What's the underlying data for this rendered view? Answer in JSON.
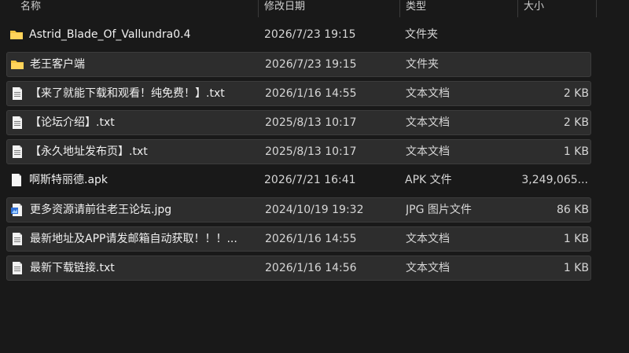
{
  "columns": {
    "name": "名称",
    "date": "修改日期",
    "type": "类型",
    "size": "大小"
  },
  "files": [
    {
      "name": "Astrid_Blade_Of_Vallundra0.4",
      "date": "2026/7/23 19:15",
      "type": "文件夹",
      "size": "",
      "icon": "folder-icon",
      "selected": false
    },
    {
      "name": "老王客户端",
      "date": "2026/7/23 19:15",
      "type": "文件夹",
      "size": "",
      "icon": "folder-icon",
      "selected": true
    },
    {
      "name": "【来了就能下载和观看！纯免费！】.txt",
      "date": "2026/1/16 14:55",
      "type": "文本文档",
      "size": "2 KB",
      "icon": "text-file-icon",
      "selected": true
    },
    {
      "name": "【论坛介绍】.txt",
      "date": "2025/8/13 10:17",
      "type": "文本文档",
      "size": "2 KB",
      "icon": "text-file-icon",
      "selected": true
    },
    {
      "name": "【永久地址发布页】.txt",
      "date": "2025/8/13 10:17",
      "type": "文本文档",
      "size": "1 KB",
      "icon": "text-file-icon",
      "selected": true
    },
    {
      "name": "啊斯特丽德.apk",
      "date": "2026/7/21 16:41",
      "type": "APK 文件",
      "size": "3,249,065...",
      "icon": "file-icon",
      "selected": false
    },
    {
      "name": "更多资源请前往老王论坛.jpg",
      "date": "2024/10/19 19:32",
      "type": "JPG 图片文件",
      "size": "86 KB",
      "icon": "image-file-icon",
      "selected": true
    },
    {
      "name": "最新地址及APP请发邮箱自动获取！！！...",
      "date": "2026/1/16 14:55",
      "type": "文本文档",
      "size": "1 KB",
      "icon": "text-file-icon",
      "selected": true
    },
    {
      "name": "最新下载链接.txt",
      "date": "2026/1/16 14:56",
      "type": "文本文档",
      "size": "1 KB",
      "icon": "text-file-icon",
      "selected": true
    }
  ]
}
